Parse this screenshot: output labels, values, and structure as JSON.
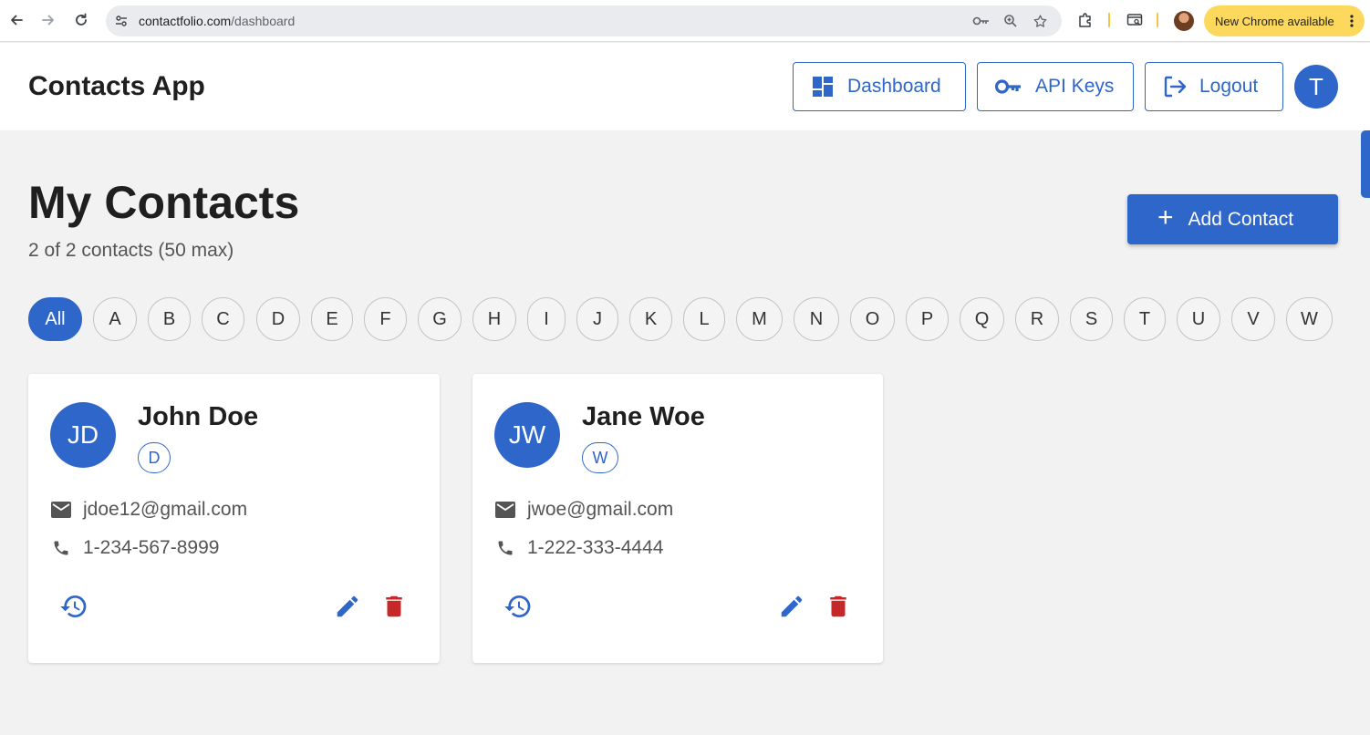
{
  "browser": {
    "url_domain": "contactfolio.com",
    "url_path": "/dashboard",
    "update_label": "New Chrome available"
  },
  "header": {
    "title": "Contacts App",
    "dashboard_label": "Dashboard",
    "api_keys_label": "API Keys",
    "logout_label": "Logout",
    "user_initial": "T"
  },
  "main": {
    "heading": "My Contacts",
    "count_text": "2 of 2 contacts (50 max)",
    "add_label": "Add Contact"
  },
  "filters": [
    "All",
    "A",
    "B",
    "C",
    "D",
    "E",
    "F",
    "G",
    "H",
    "I",
    "J",
    "K",
    "L",
    "M",
    "N",
    "O",
    "P",
    "Q",
    "R",
    "S",
    "T",
    "U",
    "V",
    "W"
  ],
  "active_filter": "All",
  "contacts": [
    {
      "initials": "JD",
      "name": "John Doe",
      "tag": "D",
      "email": "jdoe12@gmail.com",
      "phone": "1-234-567-8999"
    },
    {
      "initials": "JW",
      "name": "Jane Woe",
      "tag": "W",
      "email": "jwoe@gmail.com",
      "phone": "1-222-333-4444"
    }
  ],
  "colors": {
    "primary": "#2f66c9",
    "delete": "#c62828",
    "background": "#f2f2f2",
    "update_pill": "#fcd95d"
  },
  "icons": {
    "history": "history-icon",
    "edit": "pencil-icon",
    "delete": "trash-icon",
    "email": "mail-icon",
    "phone": "phone-icon"
  }
}
